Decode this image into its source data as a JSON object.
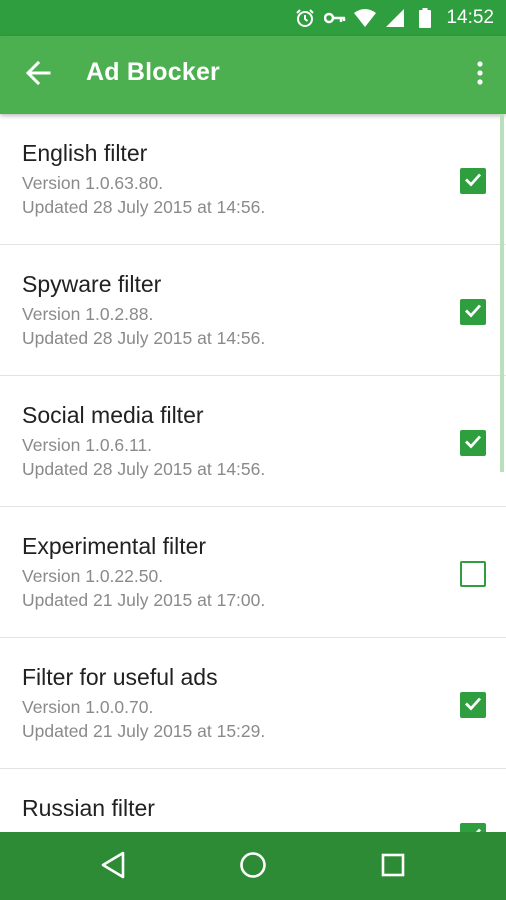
{
  "status_bar": {
    "time": "14:52",
    "icons": [
      "alarm-icon",
      "vpn-key-icon",
      "wifi-icon",
      "signal-icon",
      "battery-icon"
    ]
  },
  "app_bar": {
    "title": "Ad Blocker",
    "back_icon": "arrow-left-icon",
    "menu_icon": "more-vert-icon"
  },
  "filters": [
    {
      "name": "English filter",
      "version": "Version 1.0.63.80.",
      "updated": "Updated 28 July 2015 at 14:56.",
      "checked": true
    },
    {
      "name": "Spyware filter",
      "version": "Version 1.0.2.88.",
      "updated": "Updated 28 July 2015 at 14:56.",
      "checked": true
    },
    {
      "name": "Social media filter",
      "version": "Version 1.0.6.11.",
      "updated": "Updated 28 July 2015 at 14:56.",
      "checked": true
    },
    {
      "name": "Experimental filter",
      "version": "Version 1.0.22.50.",
      "updated": "Updated 21 July 2015 at 17:00.",
      "checked": false
    },
    {
      "name": "Filter for useful ads",
      "version": "Version 1.0.0.70.",
      "updated": "Updated 21 July 2015 at 15:29.",
      "checked": true
    },
    {
      "name": "Russian filter",
      "version": "",
      "updated": "",
      "checked": true
    }
  ],
  "colors": {
    "status_bar": "#2e9e3f",
    "app_bar": "#4caf50",
    "accent": "#2e9e3f",
    "nav_bar": "#2e8b35"
  },
  "nav_bar": {
    "icons": [
      "back-triangle-icon",
      "home-circle-icon",
      "recents-square-icon"
    ]
  }
}
